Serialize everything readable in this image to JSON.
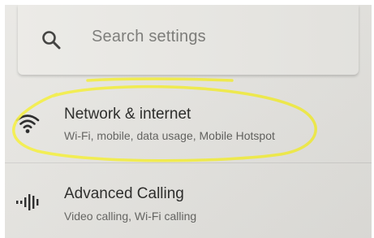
{
  "search": {
    "placeholder": "Search settings",
    "icon": "search-icon"
  },
  "settings": {
    "items": [
      {
        "title": "Network & internet",
        "subtitle": "Wi-Fi, mobile, data usage, Mobile Hotspot",
        "icon": "wifi-icon",
        "highlighted": true
      },
      {
        "title": "Advanced Calling",
        "subtitle": "Video calling, Wi-Fi calling",
        "icon": "advanced-calling-icon"
      }
    ]
  },
  "colors": {
    "highlight": "#f4ee3c",
    "background": "#e6e5e1",
    "title_text": "#262624",
    "subtitle_text": "#5f5f5c"
  }
}
